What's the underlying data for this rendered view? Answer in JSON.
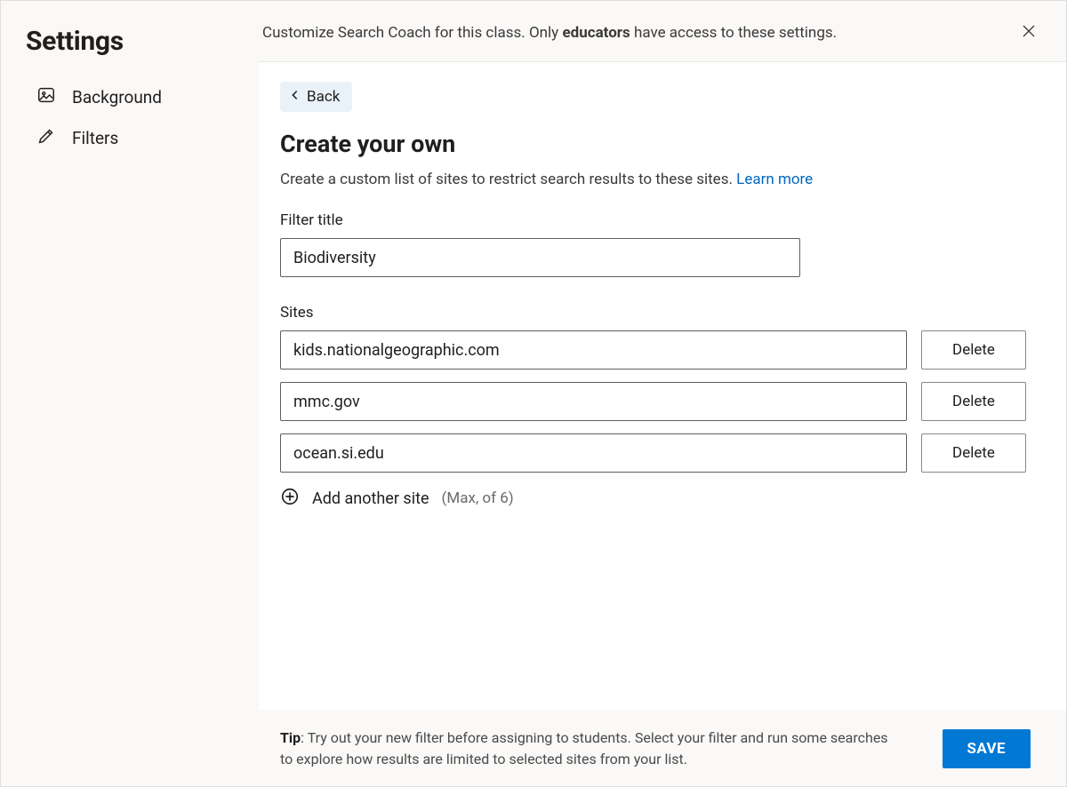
{
  "sidebar": {
    "title": "Settings",
    "items": [
      {
        "label": "Background"
      },
      {
        "label": "Filters"
      }
    ]
  },
  "header": {
    "prefix": "Customize Search Coach for this class. Only ",
    "bold": "educators",
    "suffix": " have access to these settings."
  },
  "back_label": "Back",
  "main": {
    "title": "Create your own",
    "subtitle_prefix": "Create a custom list of sites to restrict search results to these sites. ",
    "learn_more": "Learn more",
    "filter_title_label": "Filter title",
    "filter_title_value": "Biodiversity",
    "sites_label": "Sites",
    "sites": [
      "kids.nationalgeographic.com",
      "mmc.gov",
      "ocean.si.edu"
    ],
    "delete_label": "Delete",
    "add_label": "Add another site",
    "add_hint": "(Max, of 6)"
  },
  "footer": {
    "tip_label": "Tip",
    "tip_text": ": Try out your new filter before assigning to students. Select your filter and run some searches to explore how results are limited to selected sites from your list.",
    "save_label": "SAVE"
  }
}
